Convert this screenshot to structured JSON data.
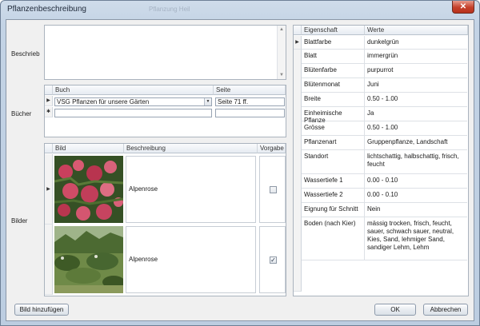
{
  "window": {
    "title": "Pflanzenbeschreibung",
    "background_title": "Pflanzung Heil",
    "close_glyph": "✕"
  },
  "labels": {
    "beschrieb": "Beschrieb",
    "buecher": "Bücher",
    "bilder": "Bilder"
  },
  "beschrieb": {
    "value": ""
  },
  "books": {
    "columns": [
      "Buch",
      "Seite"
    ],
    "rows": [
      {
        "buch": "VSG Pflanzen für unsere Gärten",
        "seite": "Seite 71 ff."
      }
    ],
    "new_row_marker": "✱"
  },
  "images": {
    "columns": [
      "Bild",
      "Beschreibung",
      "Vorgabe"
    ],
    "rows": [
      {
        "beschreibung": "Alpenrose",
        "vorgabe": false,
        "image_icon": "flower-photo"
      },
      {
        "beschreibung": "Alpenrose",
        "vorgabe": true,
        "image_icon": "landscape-photo"
      }
    ]
  },
  "properties": {
    "columns": [
      "Eigenschaft",
      "Werte"
    ],
    "rows": [
      {
        "key": "Blattfarbe",
        "value": "dunkelgrün"
      },
      {
        "key": "Blatt",
        "value": "immergrün"
      },
      {
        "key": "Blütenfarbe",
        "value": "purpurrot"
      },
      {
        "key": "Blütenmonat",
        "value": "Juni"
      },
      {
        "key": "Breite",
        "value": "0.50 - 1.00"
      },
      {
        "key": "Einheimische Pflanze",
        "value": "Ja"
      },
      {
        "key": "Grösse",
        "value": "0.50 - 1.00"
      },
      {
        "key": "Pflanzenart",
        "value": "Gruppenpflanze, Landschaft"
      },
      {
        "key": "Standort",
        "value": "lichtschattig, halbschattig, frisch, feucht"
      },
      {
        "key": "Wassertiefe 1",
        "value": "0.00 - 0.10"
      },
      {
        "key": "Wassertiefe 2",
        "value": "0.00 - 0.10"
      },
      {
        "key": "Eignung für Schnitt",
        "value": "Nein"
      },
      {
        "key": "Boden (nach Kier)",
        "value": "mässig trocken, frisch, feucht, sauer, schwach sauer, neutral, Kies, Sand, lehmiger Sand, sandiger Lehm, Lehm"
      }
    ]
  },
  "buttons": {
    "add_image": "Bild hinzufügen",
    "ok": "OK",
    "cancel": "Abbrechen"
  },
  "glyphs": {
    "current_row": "▶",
    "check": "✓",
    "dropdown": "▼",
    "scroll_up": "▲",
    "scroll_down": "▼"
  },
  "colors": {
    "accent_blue": "#c3d3e5",
    "close_red": "#c5402a"
  }
}
